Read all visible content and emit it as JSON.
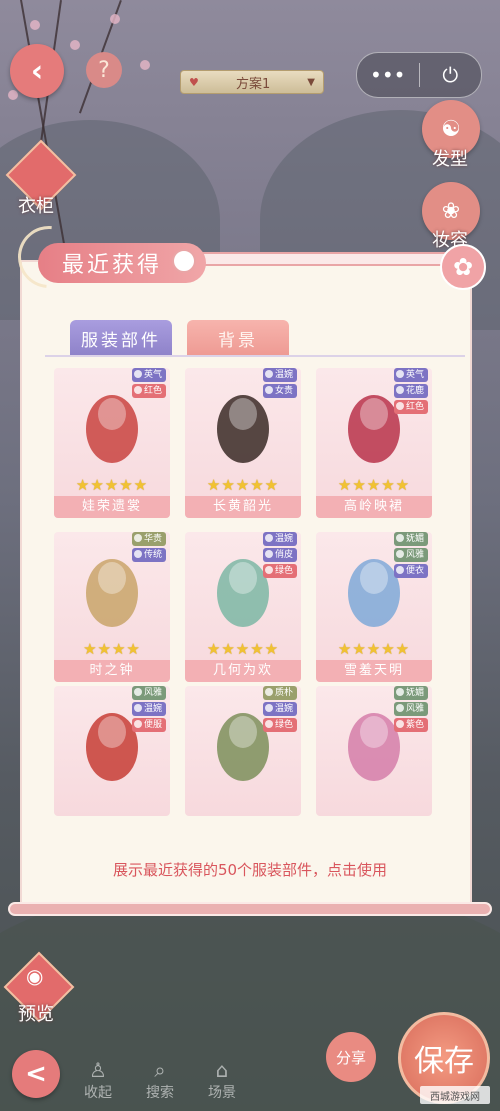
{
  "top": {
    "help_glyph": "?",
    "scheme_label": "方案1",
    "capsule_more": "•••",
    "capsule_power": "⏻"
  },
  "side_left": {
    "wardrobe_label": "衣柜",
    "preview_label": "预览"
  },
  "side_right": {
    "hair_label": "发型",
    "makeup_label": "妆容"
  },
  "panel": {
    "title": "最近获得",
    "tabs": [
      {
        "label": "服装部件",
        "active": true
      },
      {
        "label": "背景",
        "active": false
      }
    ],
    "footer_note": "展示最近获得的50个服装部件，点击使用",
    "items": [
      {
        "name": "娃荣遗裳",
        "stars": "★★★★★",
        "tags": [
          {
            "text": "英气",
            "color": "#7d73c4"
          },
          {
            "text": "红色",
            "color": "#e46f76"
          }
        ]
      },
      {
        "name": "长黄韶光",
        "stars": "★★★★★",
        "tags": [
          {
            "text": "温婉",
            "color": "#7d73c4"
          },
          {
            "text": "女贵",
            "color": "#7d73c4"
          }
        ]
      },
      {
        "name": "高岭映裙",
        "stars": "★★★★★",
        "tags": [
          {
            "text": "英气",
            "color": "#7d73c4"
          },
          {
            "text": "花鹿",
            "color": "#7d73c4"
          },
          {
            "text": "红色",
            "color": "#e46f76"
          }
        ]
      },
      {
        "name": "时之钟",
        "stars": "★★★★",
        "tags": [
          {
            "text": "华贵",
            "color": "#9aa06c"
          },
          {
            "text": "传统",
            "color": "#7d73c4"
          }
        ]
      },
      {
        "name": "几何为欢",
        "stars": "★★★★★",
        "tags": [
          {
            "text": "温婉",
            "color": "#7d73c4"
          },
          {
            "text": "俏皮",
            "color": "#7d73c4"
          },
          {
            "text": "绿色",
            "color": "#e46f76"
          }
        ]
      },
      {
        "name": "雪羞天明",
        "stars": "★★★★★",
        "tags": [
          {
            "text": "妩媚",
            "color": "#7b9a7a"
          },
          {
            "text": "风雅",
            "color": "#7b9a7a"
          },
          {
            "text": "便衣",
            "color": "#7d73c4"
          }
        ]
      },
      {
        "name": "",
        "stars": "",
        "tags": [
          {
            "text": "风雅",
            "color": "#7b9a7a"
          },
          {
            "text": "温婉",
            "color": "#7d73c4"
          },
          {
            "text": "便服",
            "color": "#e46f76"
          }
        ]
      },
      {
        "name": "",
        "stars": "",
        "tags": [
          {
            "text": "质朴",
            "color": "#9aa06c"
          },
          {
            "text": "温婉",
            "color": "#7d73c4"
          },
          {
            "text": "绿色",
            "color": "#e46f76"
          }
        ]
      },
      {
        "name": "",
        "stars": "",
        "tags": [
          {
            "text": "妩媚",
            "color": "#7b9a7a"
          },
          {
            "text": "风雅",
            "color": "#7b9a7a"
          },
          {
            "text": "紫色",
            "color": "#e46f76"
          }
        ]
      }
    ]
  },
  "bottom": {
    "back_glyph": "<",
    "icons": [
      "收起",
      "搜索",
      "场景"
    ],
    "share_label": "分享",
    "save_label": "保存",
    "watermark": "西城游戏网"
  },
  "colors": {
    "accent_pink": "#e67f86",
    "panel_bg": "#fbf6ec",
    "tab_active": "#8e82c9"
  }
}
